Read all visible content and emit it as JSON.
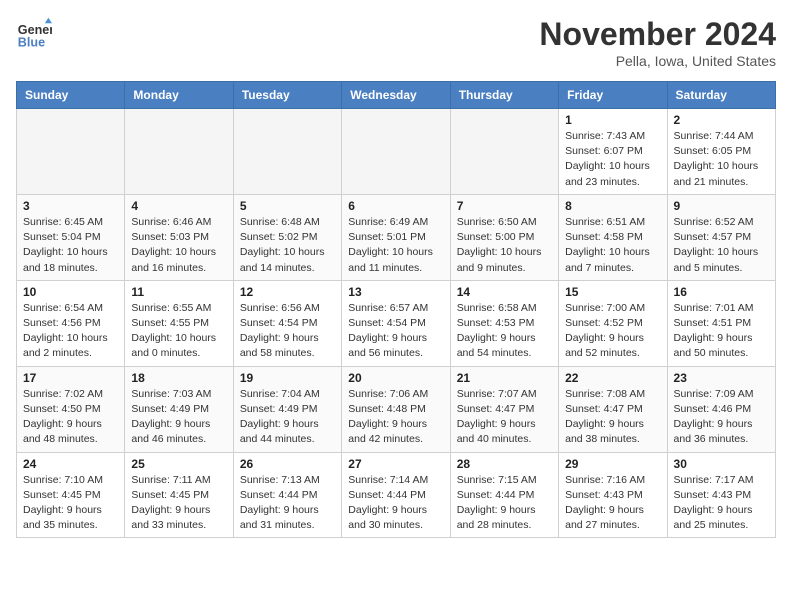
{
  "header": {
    "logo_general": "General",
    "logo_blue": "Blue",
    "month_year": "November 2024",
    "location": "Pella, Iowa, United States"
  },
  "days_of_week": [
    "Sunday",
    "Monday",
    "Tuesday",
    "Wednesday",
    "Thursday",
    "Friday",
    "Saturday"
  ],
  "weeks": [
    [
      {
        "day": "",
        "info": ""
      },
      {
        "day": "",
        "info": ""
      },
      {
        "day": "",
        "info": ""
      },
      {
        "day": "",
        "info": ""
      },
      {
        "day": "",
        "info": ""
      },
      {
        "day": "1",
        "info": "Sunrise: 7:43 AM\nSunset: 6:07 PM\nDaylight: 10 hours\nand 23 minutes."
      },
      {
        "day": "2",
        "info": "Sunrise: 7:44 AM\nSunset: 6:05 PM\nDaylight: 10 hours\nand 21 minutes."
      }
    ],
    [
      {
        "day": "3",
        "info": "Sunrise: 6:45 AM\nSunset: 5:04 PM\nDaylight: 10 hours\nand 18 minutes."
      },
      {
        "day": "4",
        "info": "Sunrise: 6:46 AM\nSunset: 5:03 PM\nDaylight: 10 hours\nand 16 minutes."
      },
      {
        "day": "5",
        "info": "Sunrise: 6:48 AM\nSunset: 5:02 PM\nDaylight: 10 hours\nand 14 minutes."
      },
      {
        "day": "6",
        "info": "Sunrise: 6:49 AM\nSunset: 5:01 PM\nDaylight: 10 hours\nand 11 minutes."
      },
      {
        "day": "7",
        "info": "Sunrise: 6:50 AM\nSunset: 5:00 PM\nDaylight: 10 hours\nand 9 minutes."
      },
      {
        "day": "8",
        "info": "Sunrise: 6:51 AM\nSunset: 4:58 PM\nDaylight: 10 hours\nand 7 minutes."
      },
      {
        "day": "9",
        "info": "Sunrise: 6:52 AM\nSunset: 4:57 PM\nDaylight: 10 hours\nand 5 minutes."
      }
    ],
    [
      {
        "day": "10",
        "info": "Sunrise: 6:54 AM\nSunset: 4:56 PM\nDaylight: 10 hours\nand 2 minutes."
      },
      {
        "day": "11",
        "info": "Sunrise: 6:55 AM\nSunset: 4:55 PM\nDaylight: 10 hours\nand 0 minutes."
      },
      {
        "day": "12",
        "info": "Sunrise: 6:56 AM\nSunset: 4:54 PM\nDaylight: 9 hours\nand 58 minutes."
      },
      {
        "day": "13",
        "info": "Sunrise: 6:57 AM\nSunset: 4:54 PM\nDaylight: 9 hours\nand 56 minutes."
      },
      {
        "day": "14",
        "info": "Sunrise: 6:58 AM\nSunset: 4:53 PM\nDaylight: 9 hours\nand 54 minutes."
      },
      {
        "day": "15",
        "info": "Sunrise: 7:00 AM\nSunset: 4:52 PM\nDaylight: 9 hours\nand 52 minutes."
      },
      {
        "day": "16",
        "info": "Sunrise: 7:01 AM\nSunset: 4:51 PM\nDaylight: 9 hours\nand 50 minutes."
      }
    ],
    [
      {
        "day": "17",
        "info": "Sunrise: 7:02 AM\nSunset: 4:50 PM\nDaylight: 9 hours\nand 48 minutes."
      },
      {
        "day": "18",
        "info": "Sunrise: 7:03 AM\nSunset: 4:49 PM\nDaylight: 9 hours\nand 46 minutes."
      },
      {
        "day": "19",
        "info": "Sunrise: 7:04 AM\nSunset: 4:49 PM\nDaylight: 9 hours\nand 44 minutes."
      },
      {
        "day": "20",
        "info": "Sunrise: 7:06 AM\nSunset: 4:48 PM\nDaylight: 9 hours\nand 42 minutes."
      },
      {
        "day": "21",
        "info": "Sunrise: 7:07 AM\nSunset: 4:47 PM\nDaylight: 9 hours\nand 40 minutes."
      },
      {
        "day": "22",
        "info": "Sunrise: 7:08 AM\nSunset: 4:47 PM\nDaylight: 9 hours\nand 38 minutes."
      },
      {
        "day": "23",
        "info": "Sunrise: 7:09 AM\nSunset: 4:46 PM\nDaylight: 9 hours\nand 36 minutes."
      }
    ],
    [
      {
        "day": "24",
        "info": "Sunrise: 7:10 AM\nSunset: 4:45 PM\nDaylight: 9 hours\nand 35 minutes."
      },
      {
        "day": "25",
        "info": "Sunrise: 7:11 AM\nSunset: 4:45 PM\nDaylight: 9 hours\nand 33 minutes."
      },
      {
        "day": "26",
        "info": "Sunrise: 7:13 AM\nSunset: 4:44 PM\nDaylight: 9 hours\nand 31 minutes."
      },
      {
        "day": "27",
        "info": "Sunrise: 7:14 AM\nSunset: 4:44 PM\nDaylight: 9 hours\nand 30 minutes."
      },
      {
        "day": "28",
        "info": "Sunrise: 7:15 AM\nSunset: 4:44 PM\nDaylight: 9 hours\nand 28 minutes."
      },
      {
        "day": "29",
        "info": "Sunrise: 7:16 AM\nSunset: 4:43 PM\nDaylight: 9 hours\nand 27 minutes."
      },
      {
        "day": "30",
        "info": "Sunrise: 7:17 AM\nSunset: 4:43 PM\nDaylight: 9 hours\nand 25 minutes."
      }
    ]
  ]
}
